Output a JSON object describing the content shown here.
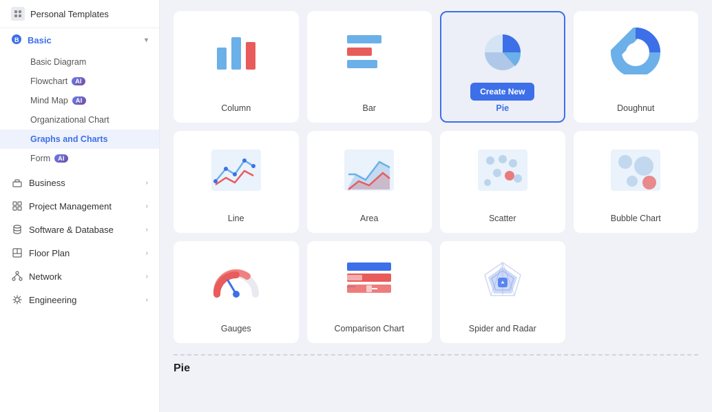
{
  "sidebar": {
    "personal_templates": "Personal Templates",
    "basic": {
      "label": "Basic",
      "icon": "bookmark-icon",
      "items": [
        {
          "label": "Basic Diagram",
          "active": false,
          "ai": false
        },
        {
          "label": "Flowchart",
          "active": false,
          "ai": true
        },
        {
          "label": "Mind Map",
          "active": false,
          "ai": true
        },
        {
          "label": "Organizational Chart",
          "active": false,
          "ai": false
        }
      ]
    },
    "graphs_and_charts": {
      "label": "Graphs and Charts",
      "active": true
    },
    "form": {
      "label": "Form",
      "ai": true
    },
    "categories": [
      {
        "id": "business",
        "label": "Business",
        "icon": "briefcase-icon"
      },
      {
        "id": "project-management",
        "label": "Project Management",
        "icon": "project-icon"
      },
      {
        "id": "software-database",
        "label": "Software & Database",
        "icon": "database-icon"
      },
      {
        "id": "floor-plan",
        "label": "Floor Plan",
        "icon": "floorplan-icon"
      },
      {
        "id": "network",
        "label": "Network",
        "icon": "network-icon"
      },
      {
        "id": "engineering",
        "label": "Engineering",
        "icon": "engineering-icon"
      }
    ]
  },
  "main": {
    "charts": [
      {
        "id": "column",
        "label": "Column",
        "selected": false
      },
      {
        "id": "bar",
        "label": "Bar",
        "selected": false
      },
      {
        "id": "pie",
        "label": "Pie",
        "selected": true
      },
      {
        "id": "doughnut",
        "label": "Doughnut",
        "selected": false
      },
      {
        "id": "line",
        "label": "Line",
        "selected": false
      },
      {
        "id": "area",
        "label": "Area",
        "selected": false
      },
      {
        "id": "scatter",
        "label": "Scatter",
        "selected": false
      },
      {
        "id": "bubble",
        "label": "Bubble Chart",
        "selected": false
      },
      {
        "id": "gauges",
        "label": "Gauges",
        "selected": false
      },
      {
        "id": "comparison",
        "label": "Comparison Chart",
        "selected": false
      },
      {
        "id": "spider",
        "label": "Spider and Radar",
        "selected": false
      }
    ],
    "create_new_label": "Create New",
    "section_label": "Pie"
  }
}
